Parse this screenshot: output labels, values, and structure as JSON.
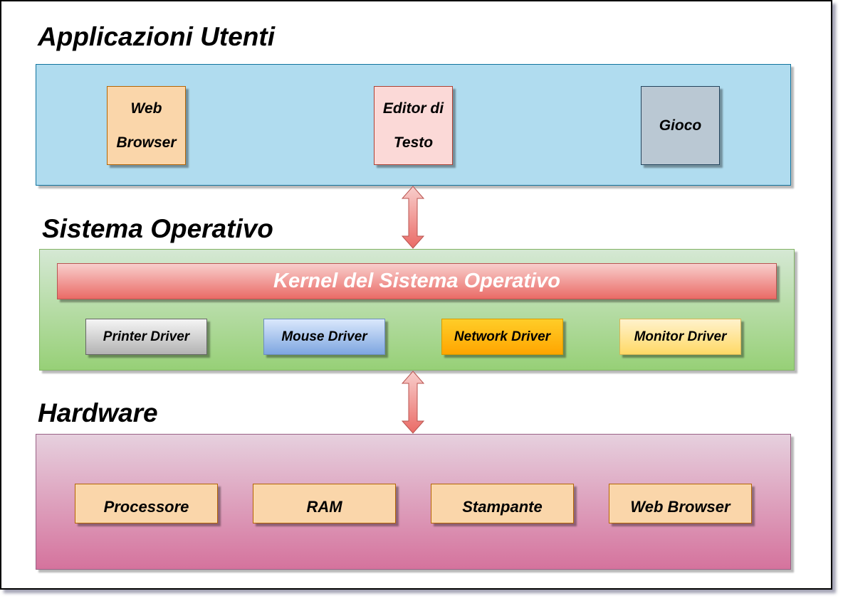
{
  "diagram": {
    "layers": [
      {
        "id": "applications",
        "title": "Applicazioni Utenti",
        "color": "#b0dcef",
        "items": [
          {
            "label": "Web Browser",
            "lines": [
              "Web",
              "Browser"
            ],
            "color": "#fad6aa"
          },
          {
            "label": "Editor di Testo",
            "lines": [
              "Editor di",
              "Testo"
            ],
            "color": "#fbd9d7"
          },
          {
            "label": "Gioco",
            "lines": [
              "Gioco"
            ],
            "color": "#bac8d3"
          }
        ]
      },
      {
        "id": "operating-system",
        "title": "Sistema Operativo",
        "color_top": "#d5e8d4",
        "color_bottom": "#97d077",
        "kernel": {
          "label": "Kernel del Sistema Operativo",
          "color_top": "#f8cecc",
          "color_bottom": "#ea6b66"
        },
        "items": [
          {
            "label": "Printer Driver",
            "color_top": "#f5f5f5",
            "color_bottom": "#b3b3b3"
          },
          {
            "label": "Mouse Driver",
            "color_top": "#dae8fc",
            "color_bottom": "#7ea6e0"
          },
          {
            "label": "Network Driver",
            "color_top": "#ffcd28",
            "color_bottom": "#ffa500"
          },
          {
            "label": "Monitor Driver",
            "color_top": "#fff2cc",
            "color_bottom": "#ffd966"
          }
        ]
      },
      {
        "id": "hardware",
        "title": "Hardware",
        "color_top": "#e6d0de",
        "color_bottom": "#d5739d",
        "items": [
          {
            "label": "Processore",
            "color": "#fad6aa"
          },
          {
            "label": "RAM",
            "color": "#fad6aa"
          },
          {
            "label": "Stampante",
            "color": "#fad6aa"
          },
          {
            "label": "Web Browser",
            "color": "#fad6aa"
          }
        ]
      }
    ],
    "connectors": [
      {
        "from": "applications",
        "to": "operating-system",
        "type": "bidirectional-arrow",
        "color": "#ea6b66"
      },
      {
        "from": "operating-system",
        "to": "hardware",
        "type": "bidirectional-arrow",
        "color": "#ea6b66"
      }
    ]
  }
}
